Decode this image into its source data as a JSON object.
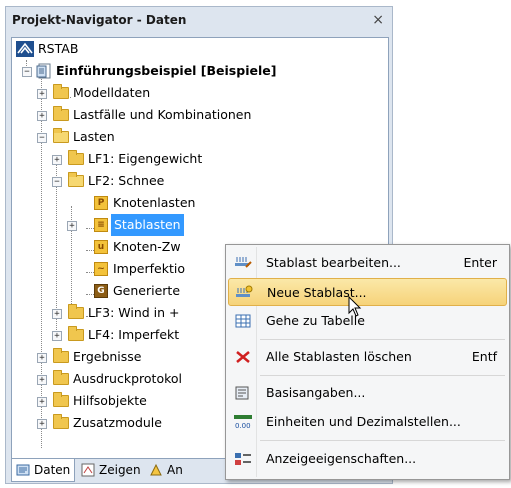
{
  "panel": {
    "title": "Projekt-Navigator - Daten",
    "close_glyph": "×"
  },
  "tree": {
    "root": "RSTAB",
    "project": "Einführungsbeispiel [Beispiele]",
    "items": {
      "modelldaten": "Modelldaten",
      "lastfaelle": "Lastfälle und Kombinationen",
      "lasten": "Lasten",
      "lf1": "LF1: Eigengewicht",
      "lf2": "LF2: Schnee",
      "knotenlasten": "Knotenlasten",
      "stablasten": "Stablasten",
      "knoten_zw": "Knoten-Zw",
      "imperfektio": "Imperfektio",
      "generierte": "Generierte",
      "lf3": "LF3: Wind in +",
      "lf4": "LF4: Imperfekt",
      "ergebnisse": "Ergebnisse",
      "ausdruck": "Ausdruckprotokol",
      "hilfsobjekte": "Hilfsobjekte",
      "zusatzmodule": "Zusatzmodule"
    },
    "expanders": {
      "plus": "+",
      "minus": "−"
    }
  },
  "tabs": [
    "Daten",
    "Zeigen",
    "An"
  ],
  "context_menu": {
    "items": [
      {
        "label": "Stablast bearbeiten...",
        "shortcut": "Enter",
        "icon": "edit-load-icon"
      },
      {
        "label": "Neue Stablast...",
        "shortcut": "",
        "icon": "new-load-icon"
      },
      {
        "label": "Gehe zu Tabelle",
        "shortcut": "",
        "icon": "table-icon"
      },
      {
        "label": "Alle Stablasten löschen",
        "shortcut": "Entf",
        "icon": "delete-icon"
      },
      {
        "label": "Basisangaben...",
        "shortcut": "",
        "icon": "general-data-icon"
      },
      {
        "label": "Einheiten und Dezimalstellen...",
        "shortcut": "",
        "icon": "units-icon"
      },
      {
        "label": "Anzeigeeigenschaften...",
        "shortcut": "",
        "icon": "display-properties-icon"
      }
    ],
    "units_icon_text": "0.00"
  },
  "colors": {
    "selection": "#3399ff",
    "menu_hover": "#f6d37a",
    "panel_bg": "#dde5ef"
  }
}
